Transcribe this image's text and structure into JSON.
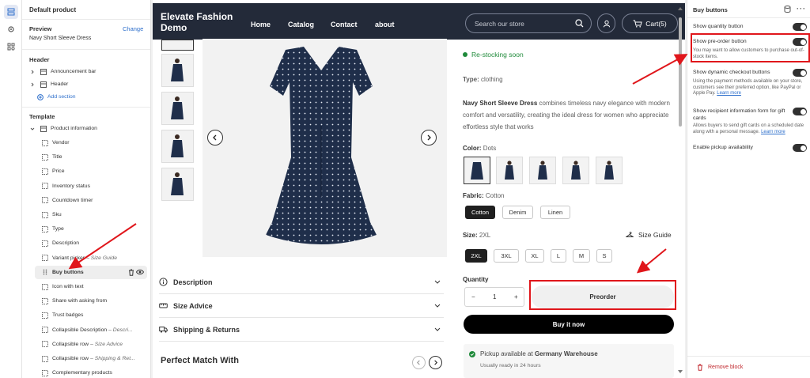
{
  "left": {
    "title": "Default product",
    "preview_label": "Preview",
    "preview_change": "Change",
    "preview_value": "Navy Short Sleeve Dress",
    "header_label": "Header",
    "header_items": [
      "Announcement bar",
      "Header"
    ],
    "add_section": "Add section",
    "template_label": "Template",
    "product_info": "Product information",
    "blocks": [
      {
        "label": "Vendor",
        "sub": ""
      },
      {
        "label": "Title",
        "sub": ""
      },
      {
        "label": "Price",
        "sub": ""
      },
      {
        "label": "Inventory status",
        "sub": ""
      },
      {
        "label": "Countdown timer",
        "sub": ""
      },
      {
        "label": "Sku",
        "sub": ""
      },
      {
        "label": "Type",
        "sub": ""
      },
      {
        "label": "Description",
        "sub": ""
      },
      {
        "label": "Variant picker",
        "sub": "– Size Guide"
      },
      {
        "label": "Buy buttons",
        "sub": ""
      },
      {
        "label": "Icon with text",
        "sub": ""
      },
      {
        "label": "Share with asking from",
        "sub": ""
      },
      {
        "label": "Trust badges",
        "sub": ""
      },
      {
        "label": "Collapsible Description",
        "sub": "– Descri..."
      },
      {
        "label": "Collapsible row",
        "sub": "– Size Advice"
      },
      {
        "label": "Collapsible row",
        "sub": "– Shipping & Ret..."
      },
      {
        "label": "Complementary products",
        "sub": ""
      }
    ]
  },
  "store": {
    "brand_line1": "Elevate Fashion",
    "brand_line2": "Demo",
    "nav": [
      "Home",
      "Catalog",
      "Contact",
      "about"
    ],
    "search_placeholder": "Search our store",
    "cart": "Cart(5)"
  },
  "product": {
    "stock": "Re-stocking soon",
    "type_label": "Type:",
    "type_value": "clothing",
    "desc_bold": "Navy Short Sleeve Dress",
    "desc_rest": " combines timeless navy elegance with modern comfort and versatility, creating the ideal dress for women who appreciate effortless style that works",
    "color_label": "Color:",
    "color_value": "Dots",
    "fabric_label": "Fabric:",
    "fabric_value": "Cotton",
    "fabrics": [
      "Cotton",
      "Denim",
      "Linen"
    ],
    "size_label": "Size:",
    "size_value": "2XL",
    "size_guide": "Size Guide",
    "sizes": [
      "2XL",
      "3XL",
      "XL",
      "L",
      "M",
      "S"
    ],
    "quantity_label": "Quantity",
    "quantity_value": "1",
    "qty_minus": "−",
    "qty_plus": "+",
    "preorder": "Preorder",
    "buy_now": "Buy it now",
    "pickup_prefix": "Pickup available at ",
    "pickup_location": "Germany Warehouse",
    "pickup_time": "Usually ready in 24 hours",
    "accordions": [
      "Description",
      "Size Advice",
      "Shipping & Returns"
    ],
    "perfect_match": "Perfect Match With"
  },
  "right": {
    "title": "Buy buttons",
    "settings": [
      {
        "label": "Show quantity button",
        "help": "",
        "help_link": ""
      },
      {
        "label": "Show pre-order button",
        "help": "You may want to allow customers to purchase out-of-stock items.",
        "help_link": ""
      },
      {
        "label": "Show dynamic checkout buttons",
        "help": "Using the payment methods available on your store, customers see their preferred option, like PayPal or Apple Pay.",
        "help_link": "Learn more"
      },
      {
        "label": "Show recipient information form for gift cards",
        "help": "Allows buyers to send gift cards on a scheduled date along with a personal message.",
        "help_link": "Learn more"
      },
      {
        "label": "Enable pickup availability",
        "help": "",
        "help_link": ""
      }
    ],
    "remove_block": "Remove block"
  },
  "colors": {
    "nav_bg": "#232a39",
    "dress": "#1f2e4a",
    "highlight": "#e0161b",
    "link": "#2c6ecb",
    "in_stock": "#1f8a3a",
    "danger": "#c0272d"
  }
}
